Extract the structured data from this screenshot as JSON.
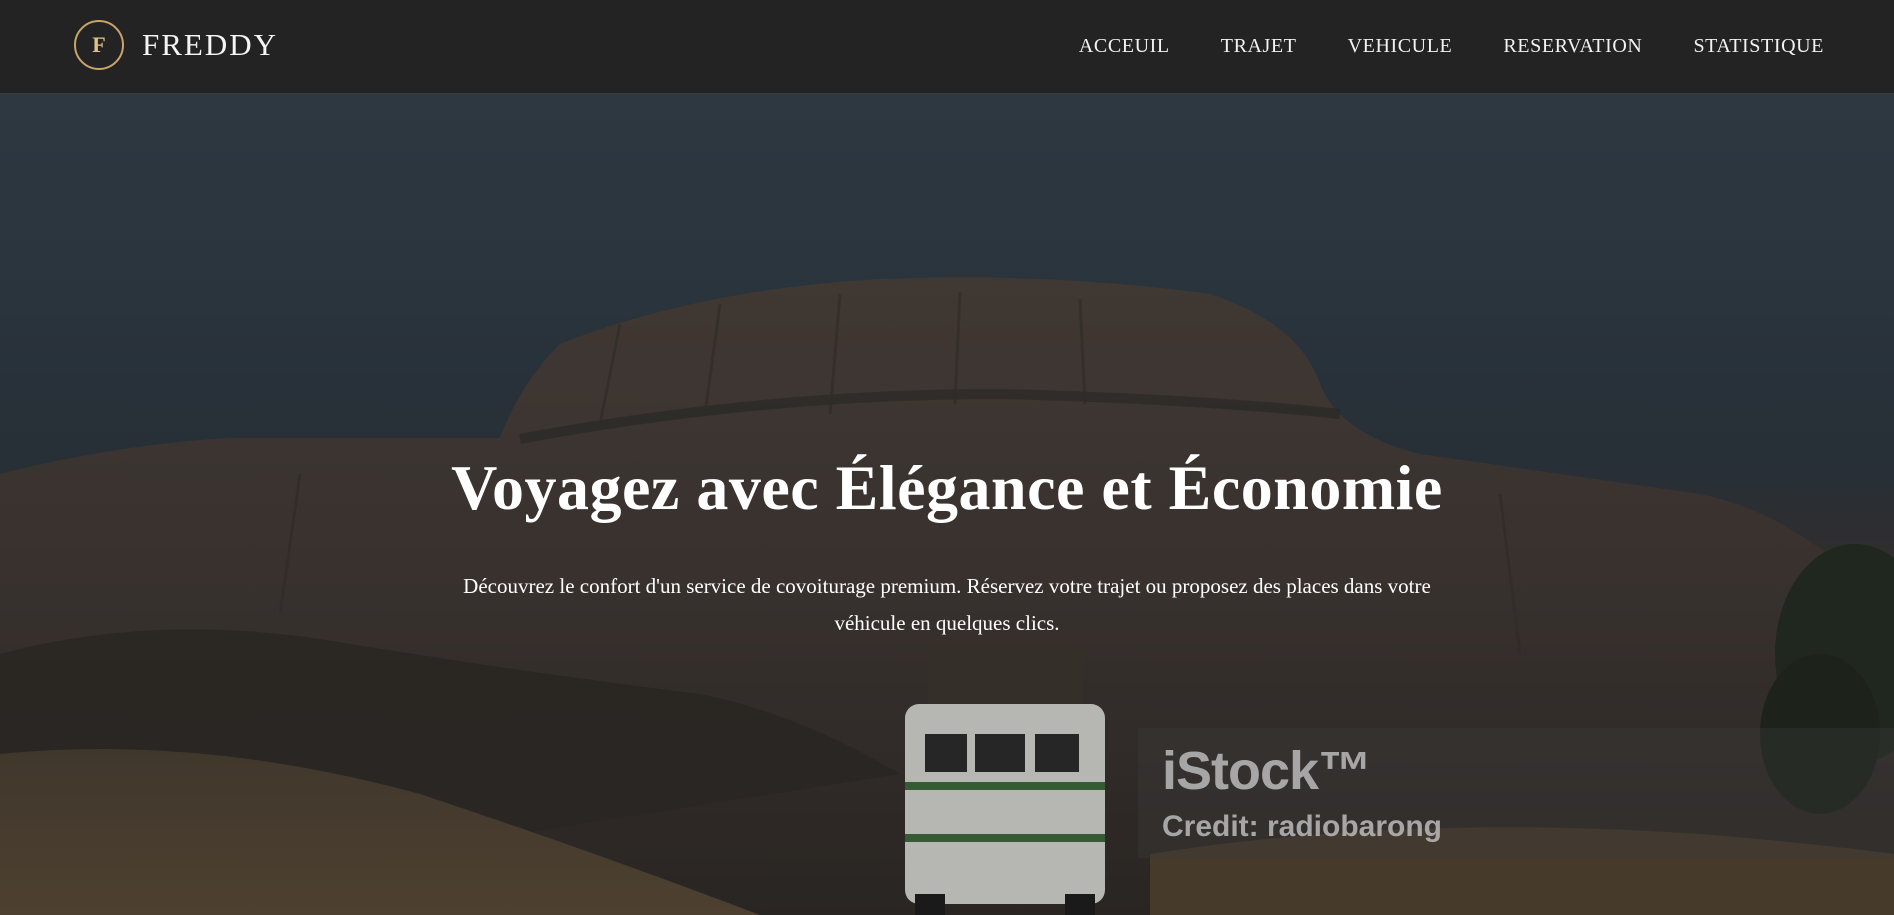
{
  "brand": {
    "logo_letter": "F",
    "name": "FREDDY"
  },
  "nav": {
    "items": [
      {
        "label": "ACCEUIL"
      },
      {
        "label": "TRAJET"
      },
      {
        "label": "VEHICULE"
      },
      {
        "label": "RESERVATION"
      },
      {
        "label": "STATISTIQUE"
      }
    ]
  },
  "hero": {
    "title": "Voyagez avec Élégance et Économie",
    "text": "Découvrez le confort d'un service de covoiturage premium. Réservez votre trajet ou proposez des places dans votre véhicule en quelques clics."
  },
  "watermark": {
    "brand": "iStock™",
    "credit": "Credit: radiobarong"
  },
  "colors": {
    "navbar_bg": "#232323",
    "logo_accent": "#c9a46a",
    "text_light": "#ffffff"
  }
}
